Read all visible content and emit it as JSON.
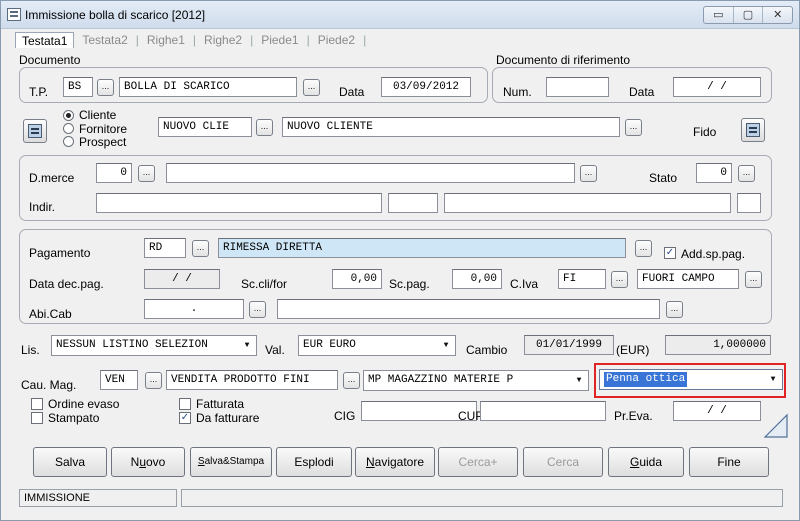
{
  "window": {
    "title": "Immissione bolla di scarico [2012]"
  },
  "window_buttons": {
    "minimize": "▭",
    "maximize": "▢",
    "close": "✕"
  },
  "tabs": [
    {
      "label": "Testata1"
    },
    {
      "label": "Testata2"
    },
    {
      "label": "Righe1"
    },
    {
      "label": "Righe2"
    },
    {
      "label": "Piede1"
    },
    {
      "label": "Piede2"
    }
  ],
  "documento": {
    "group_label": "Documento",
    "tp_label": "T.P.",
    "tp_value": "BS",
    "tp_desc": "BOLLA DI SCARICO",
    "data_label": "Data",
    "data_value": "03/09/2012"
  },
  "riferimento": {
    "group_label": "Documento di riferimento",
    "num_label": "Num.",
    "num_value": "",
    "data_label": "Data",
    "data_value": "/  /"
  },
  "soggetto": {
    "options": [
      "Cliente",
      "Fornitore",
      "Prospect"
    ],
    "code": "NUOVO CLIE",
    "name": "NUOVO CLIENTE",
    "fido_label": "Fido"
  },
  "merce": {
    "dmerce_label": "D.merce",
    "dmerce_value": "0",
    "dmerce_desc": "",
    "stato_label": "Stato",
    "stato_value": "0",
    "indir_label": "Indir."
  },
  "pagamento": {
    "label": "Pagamento",
    "code": "RD",
    "desc": "RIMESSA DIRETTA",
    "addsp_label": "Add.sp.pag.",
    "datadec_label": "Data dec.pag.",
    "datadec_value": "/  /",
    "sccli_label": "Sc.cli/for",
    "sccli_value": "0,00",
    "scpag_label": "Sc.pag.",
    "scpag_value": "0,00",
    "civa_label": "C.Iva",
    "civa_code": "FI",
    "civa_desc": "FUORI CAMPO",
    "abicab_label": "Abi.Cab",
    "abicab_value": "."
  },
  "listino": {
    "lis_label": "Lis.",
    "lis_value": "NESSUN LISTINO SELEZION",
    "val_label": "Val.",
    "val_value": "EUR  EURO",
    "cambio_label": "Cambio",
    "cambio_date": "01/01/1999",
    "cambio_currency": "(EUR)",
    "cambio_value": "1,000000"
  },
  "causale": {
    "label": "Cau. Mag.",
    "code": "VEN",
    "desc": "VENDITA PRODOTTO FINI",
    "magazzino": "MP   MAGAZZINO MATERIE P",
    "penna": "Penna ottica"
  },
  "flags": {
    "ordine_evaso": "Ordine evaso",
    "stampato": "Stampato",
    "fatturata": "Fatturata",
    "da_fatturare": "Da fatturare",
    "cig_label": "CIG",
    "cup_label": "CUP",
    "preva_label": "Pr.Eva.",
    "preva_value": "/  /"
  },
  "buttons": {
    "salva": "Salva",
    "nuovo_pre": "N",
    "nuovo_u": "u",
    "nuovo_post": "ovo",
    "salva_stampa_pre": "",
    "salva_stampa_u": "S",
    "salva_stampa_post": "alva&Stampa",
    "esplodi": "Esplodi",
    "navigatore_u": "N",
    "navigatore_post": "avigatore",
    "cerca_plus": "Cerca+",
    "cerca": "Cerca",
    "guida_u": "G",
    "guida_post": "uida",
    "fine": "Fine"
  },
  "status": {
    "mode": "IMMISSIONE"
  },
  "colors": {
    "highlight_border": "#e02424",
    "selection": "#3875d7",
    "blue_field": "#cfe6f6"
  }
}
